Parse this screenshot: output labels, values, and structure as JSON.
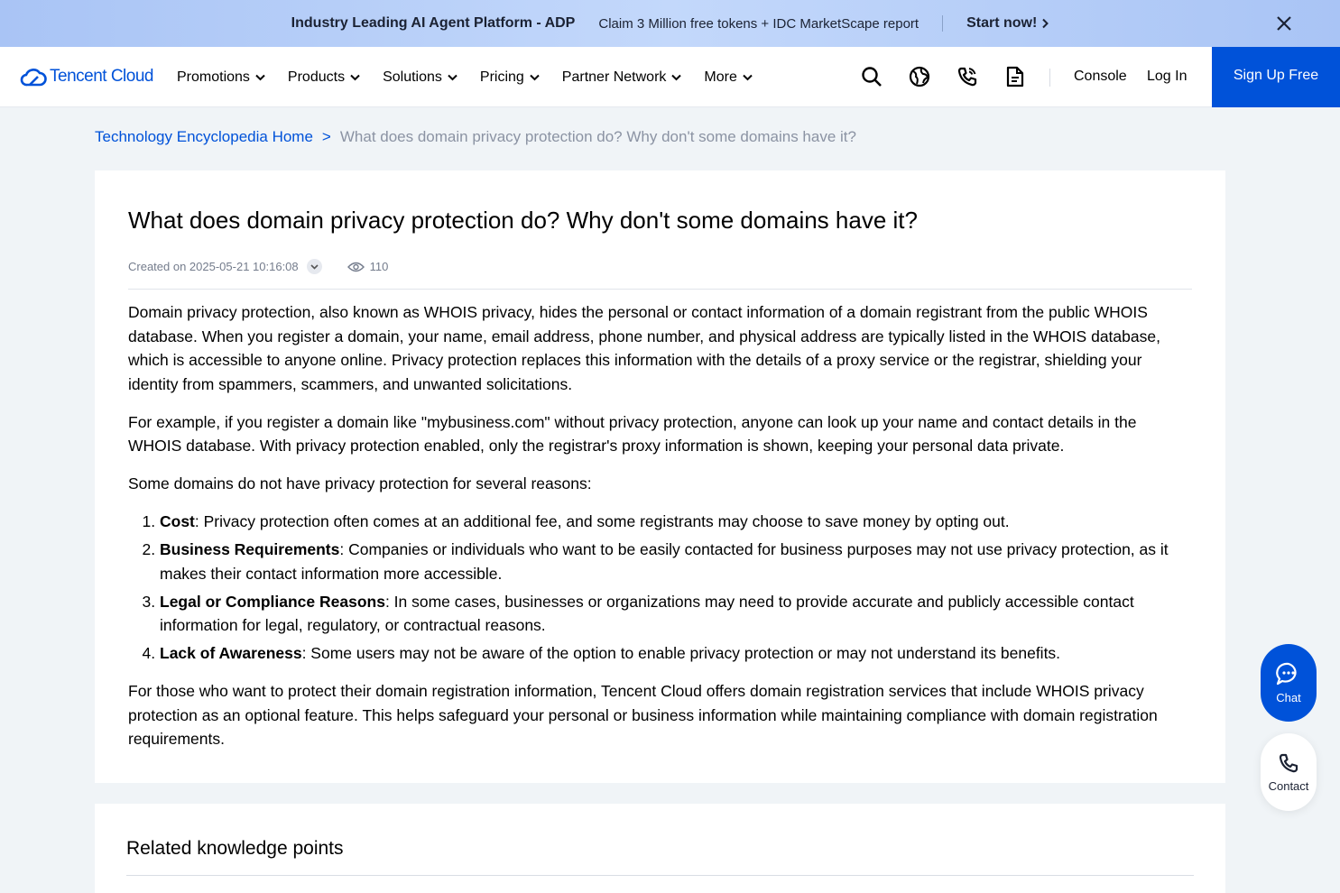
{
  "promo": {
    "title": "Industry Leading AI Agent Platform - ADP",
    "subtitle": "Claim 3 Million free tokens + IDC MarketScape report",
    "cta": "Start now!"
  },
  "nav": {
    "logo_text": "Tencent Cloud",
    "menu": [
      "Promotions",
      "Products",
      "Solutions",
      "Pricing",
      "Partner Network",
      "More"
    ],
    "console": "Console",
    "login": "Log In",
    "signup": "Sign Up Free"
  },
  "breadcrumb": {
    "home": "Technology Encyclopedia Home",
    "separator": ">",
    "current": "What does domain privacy protection do? Why don't some domains have it?"
  },
  "article": {
    "title": "What does domain privacy protection do? Why don't some domains have it?",
    "created": "Created on 2025-05-21 10:16:08",
    "views": "110",
    "paragraphs": [
      "Domain privacy protection, also known as WHOIS privacy, hides the personal or contact information of a domain registrant from the public WHOIS database. When you register a domain, your name, email address, phone number, and physical address are typically listed in the WHOIS database, which is accessible to anyone online. Privacy protection replaces this information with the details of a proxy service or the registrar, shielding your identity from spammers, scammers, and unwanted solicitations.",
      "For example, if you register a domain like \"mybusiness.com\" without privacy protection, anyone can look up your name and contact details in the WHOIS database. With privacy protection enabled, only the registrar's proxy information is shown, keeping your personal data private.",
      "Some domains do not have privacy protection for several reasons:"
    ],
    "reasons": [
      {
        "term": "Cost",
        "text": ": Privacy protection often comes at an additional fee, and some registrants may choose to save money by opting out."
      },
      {
        "term": "Business Requirements",
        "text": ": Companies or individuals who want to be easily contacted for business purposes may not use privacy protection, as it makes their contact information more accessible."
      },
      {
        "term": "Legal or Compliance Reasons",
        "text": ": In some cases, businesses or organizations may need to provide accurate and publicly accessible contact information for legal, regulatory, or contractual reasons."
      },
      {
        "term": "Lack of Awareness",
        "text": ": Some users may not be aware of the option to enable privacy protection or may not understand its benefits."
      }
    ],
    "closing": "For those who want to protect their domain registration information, Tencent Cloud offers domain registration services that include WHOIS privacy protection as an optional feature. This helps safeguard your personal or business information while maintaining compliance with domain registration requirements."
  },
  "related": {
    "title": "Related knowledge points"
  },
  "floating": {
    "chat": "Chat",
    "contact": "Contact"
  },
  "colors": {
    "brand": "#0052d9",
    "page_bg": "#f0f4f7",
    "muted_text": "#8b93a3"
  },
  "icons": [
    "close-icon",
    "chevron-right-icon",
    "chevron-down-icon",
    "search-icon",
    "globe-icon",
    "phone-icon",
    "document-icon",
    "eye-icon",
    "chat-icon"
  ]
}
